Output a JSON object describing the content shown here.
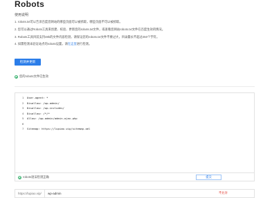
{
  "page": {
    "title": "Robots",
    "usage_label": "使用说明",
    "instructions": [
      {
        "text": "1. robots.txt可以告诉百度您网站的哪些页面可以被抓取，哪些页面不可以被抓取。"
      },
      {
        "text": "2. 您可以通过Robots工具来创建、校验、更新您的robots.txt文件，或查看您网站robots.txt文件在百度生效的情况。"
      },
      {
        "text": "3. Robots工具目前支持48k的文件内容检测，请保证您的robots.txt文件不要过大，目录最长不超过250个字符。"
      },
      {
        "text": "4. 如需检测未验证站点的robots设置，请",
        "link": "在这里",
        "suffix": "进行检测。"
      }
    ]
  },
  "detect": {
    "button_label": "检测并更新"
  },
  "status": {
    "file_detected": "您的robots文件已生效",
    "syntax_ok": "robots语法检测正确"
  },
  "editor": {
    "lines": [
      {
        "num": "1",
        "text": "User-agent: *"
      },
      {
        "num": "2",
        "text": "Disallow: /wp-admin/"
      },
      {
        "num": "3",
        "text": "Disallow: /wp-includes/"
      },
      {
        "num": "4",
        "text": "Disallow: /*/*"
      },
      {
        "num": "5",
        "text": "Allow: /wp-admin/admin-ajax.php"
      },
      {
        "num": "6",
        "text": ""
      },
      {
        "num": "7",
        "text": "Sitemap: https://lupiao.vip/sitemap.xml"
      }
    ],
    "submit_label": "提交"
  },
  "url_check": {
    "prefix": "https://lupiao.vip/",
    "value": "wp-admin",
    "result": "不允许"
  },
  "colors": {
    "accent": "#2b7de9",
    "success": "#3cb371",
    "error": "#e03c31"
  }
}
